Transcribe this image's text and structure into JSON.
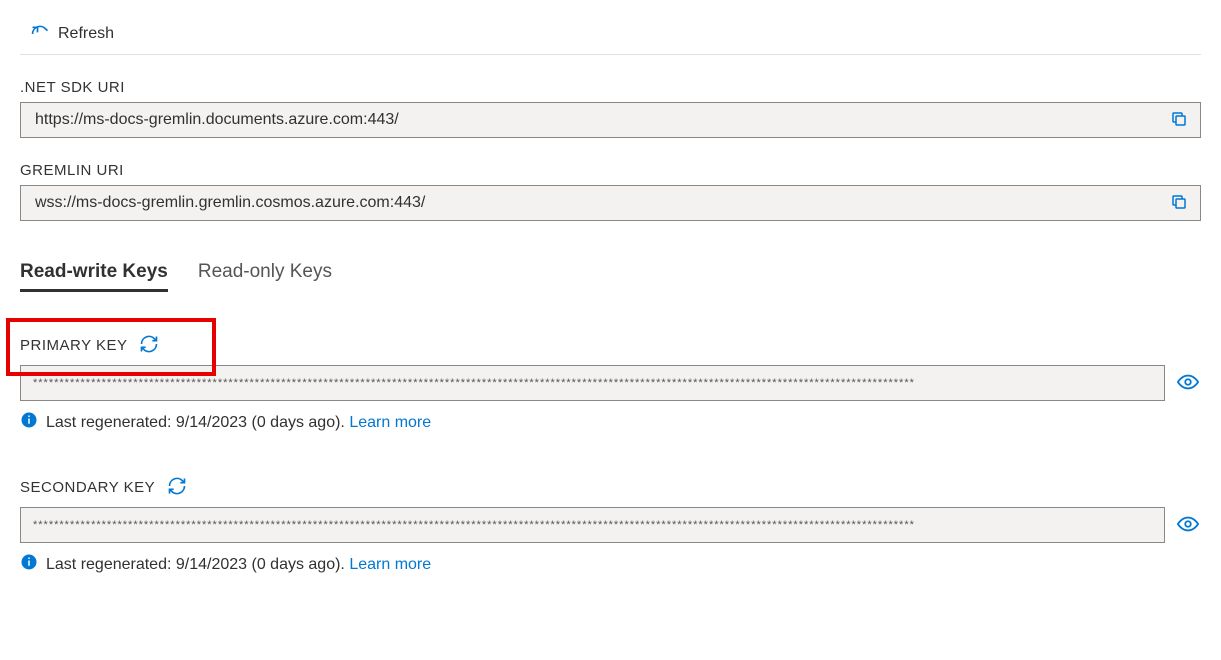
{
  "toolbar": {
    "refresh_label": "Refresh"
  },
  "uris": {
    "sdk_label": ".NET SDK URI",
    "sdk_value": "https://ms-docs-gremlin.documents.azure.com:443/",
    "gremlin_label": "GREMLIN URI",
    "gremlin_value": "wss://ms-docs-gremlin.gremlin.cosmos.azure.com:443/"
  },
  "tabs": {
    "rw_label": "Read-write Keys",
    "ro_label": "Read-only Keys"
  },
  "keys": {
    "primary": {
      "label": "PRIMARY KEY",
      "masked": "***********************************************************************************************************************************************************************",
      "info_prefix": "Last regenerated: 9/14/2023 (0 days ago). ",
      "learn_more": "Learn more"
    },
    "secondary": {
      "label": "SECONDARY KEY",
      "masked": "***********************************************************************************************************************************************************************",
      "info_prefix": "Last regenerated: 9/14/2023 (0 days ago). ",
      "learn_more": "Learn more"
    }
  }
}
